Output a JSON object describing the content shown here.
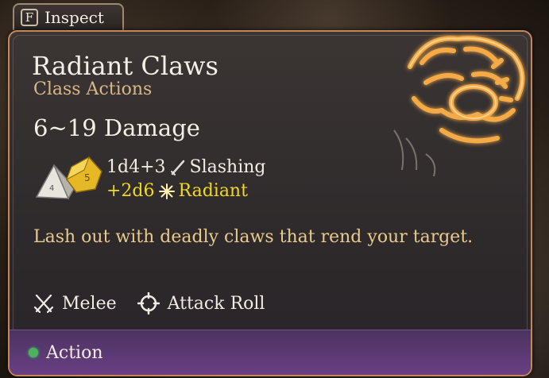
{
  "inspect": {
    "key": "F",
    "label": "Inspect"
  },
  "spell": {
    "name": "Radiant Claws",
    "category": "Class Actions",
    "damage_range": "6~19 Damage",
    "dice_icon": "dice-icon",
    "damage_lines": [
      {
        "dice": "1d4+3",
        "type": "Slashing",
        "icon": "slashing-icon",
        "color": "#f2ece4"
      },
      {
        "dice": "+2d6",
        "type": "Radiant",
        "icon": "radiant-icon",
        "color": "#f3d81e"
      }
    ],
    "description": "Lash out with deadly claws that rend your target.",
    "tags": [
      {
        "label": "Melee",
        "icon": "melee-crossed-swords-icon"
      },
      {
        "label": "Attack Roll",
        "icon": "crosshair-icon"
      }
    ],
    "cost": {
      "label": "Action",
      "indicator_color": "#4fb15e"
    }
  },
  "colors": {
    "accent_border": "#c4875a",
    "category_text": "#d9b887",
    "description_text": "#e9c98c",
    "footer_purple": "#6a3f84"
  }
}
